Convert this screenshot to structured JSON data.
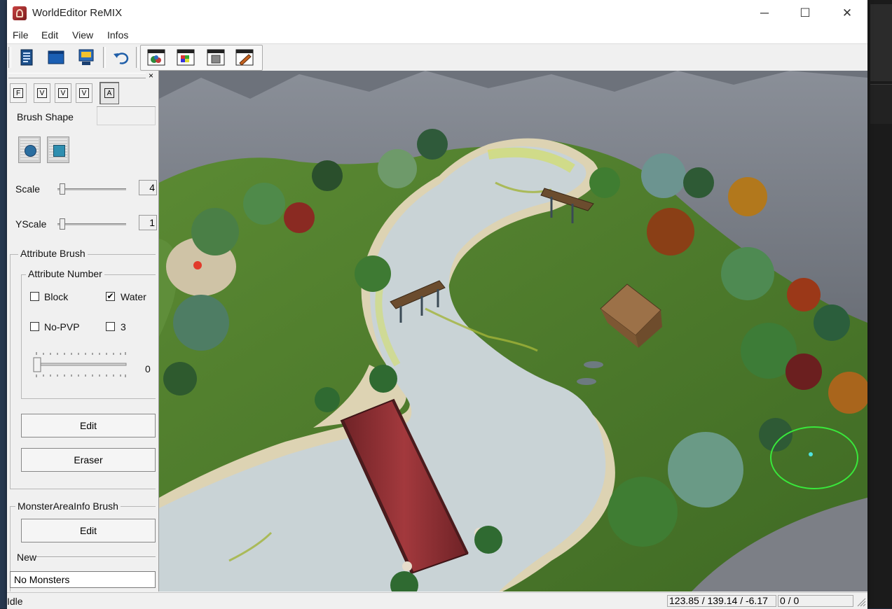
{
  "window": {
    "title": "WorldEditor ReMIX",
    "controls": {
      "minimize": "─",
      "maximize": "☐",
      "close": "✕"
    }
  },
  "menu": [
    "File",
    "Edit",
    "View",
    "Infos"
  ],
  "toolbar": {
    "buttons": [
      "new-file-icon",
      "open-icon",
      "save-icon",
      "undo-icon",
      "terrain-icon",
      "texture-icon",
      "object-icon",
      "edit-pencil-icon"
    ]
  },
  "panel": {
    "close": "×",
    "mode_buttons": [
      "F",
      "V",
      "V",
      "V",
      "A"
    ],
    "brush_shape_label": "Brush Shape",
    "scale": {
      "label": "Scale",
      "value": "4"
    },
    "yscale": {
      "label": "YScale",
      "value": "1"
    },
    "attribute_brush": {
      "title": "Attribute Brush",
      "attribute_number": "Attribute Number",
      "checkboxes": [
        {
          "label": "Block",
          "checked": false
        },
        {
          "label": "Water",
          "checked": true
        },
        {
          "label": "No-PVP",
          "checked": false
        },
        {
          "label": "3",
          "checked": false
        }
      ],
      "slider_value": "0",
      "edit": "Edit",
      "eraser": "Eraser"
    },
    "monster_area": {
      "title": "MonsterAreaInfo Brush",
      "edit": "Edit",
      "new_label": "New",
      "value": "No Monsters"
    }
  },
  "status": {
    "text": "Idle",
    "coords": "123.85 / 139.14 / -6.17",
    "counter": "0 / 0"
  },
  "colors": {
    "grass": "#4f7d2d",
    "water": "#c8d2d5",
    "sand": "#d8d0b4",
    "mountain": "#5a5e66",
    "bridge_red": "#8a2f33",
    "brush_ring": "#39e83b"
  }
}
